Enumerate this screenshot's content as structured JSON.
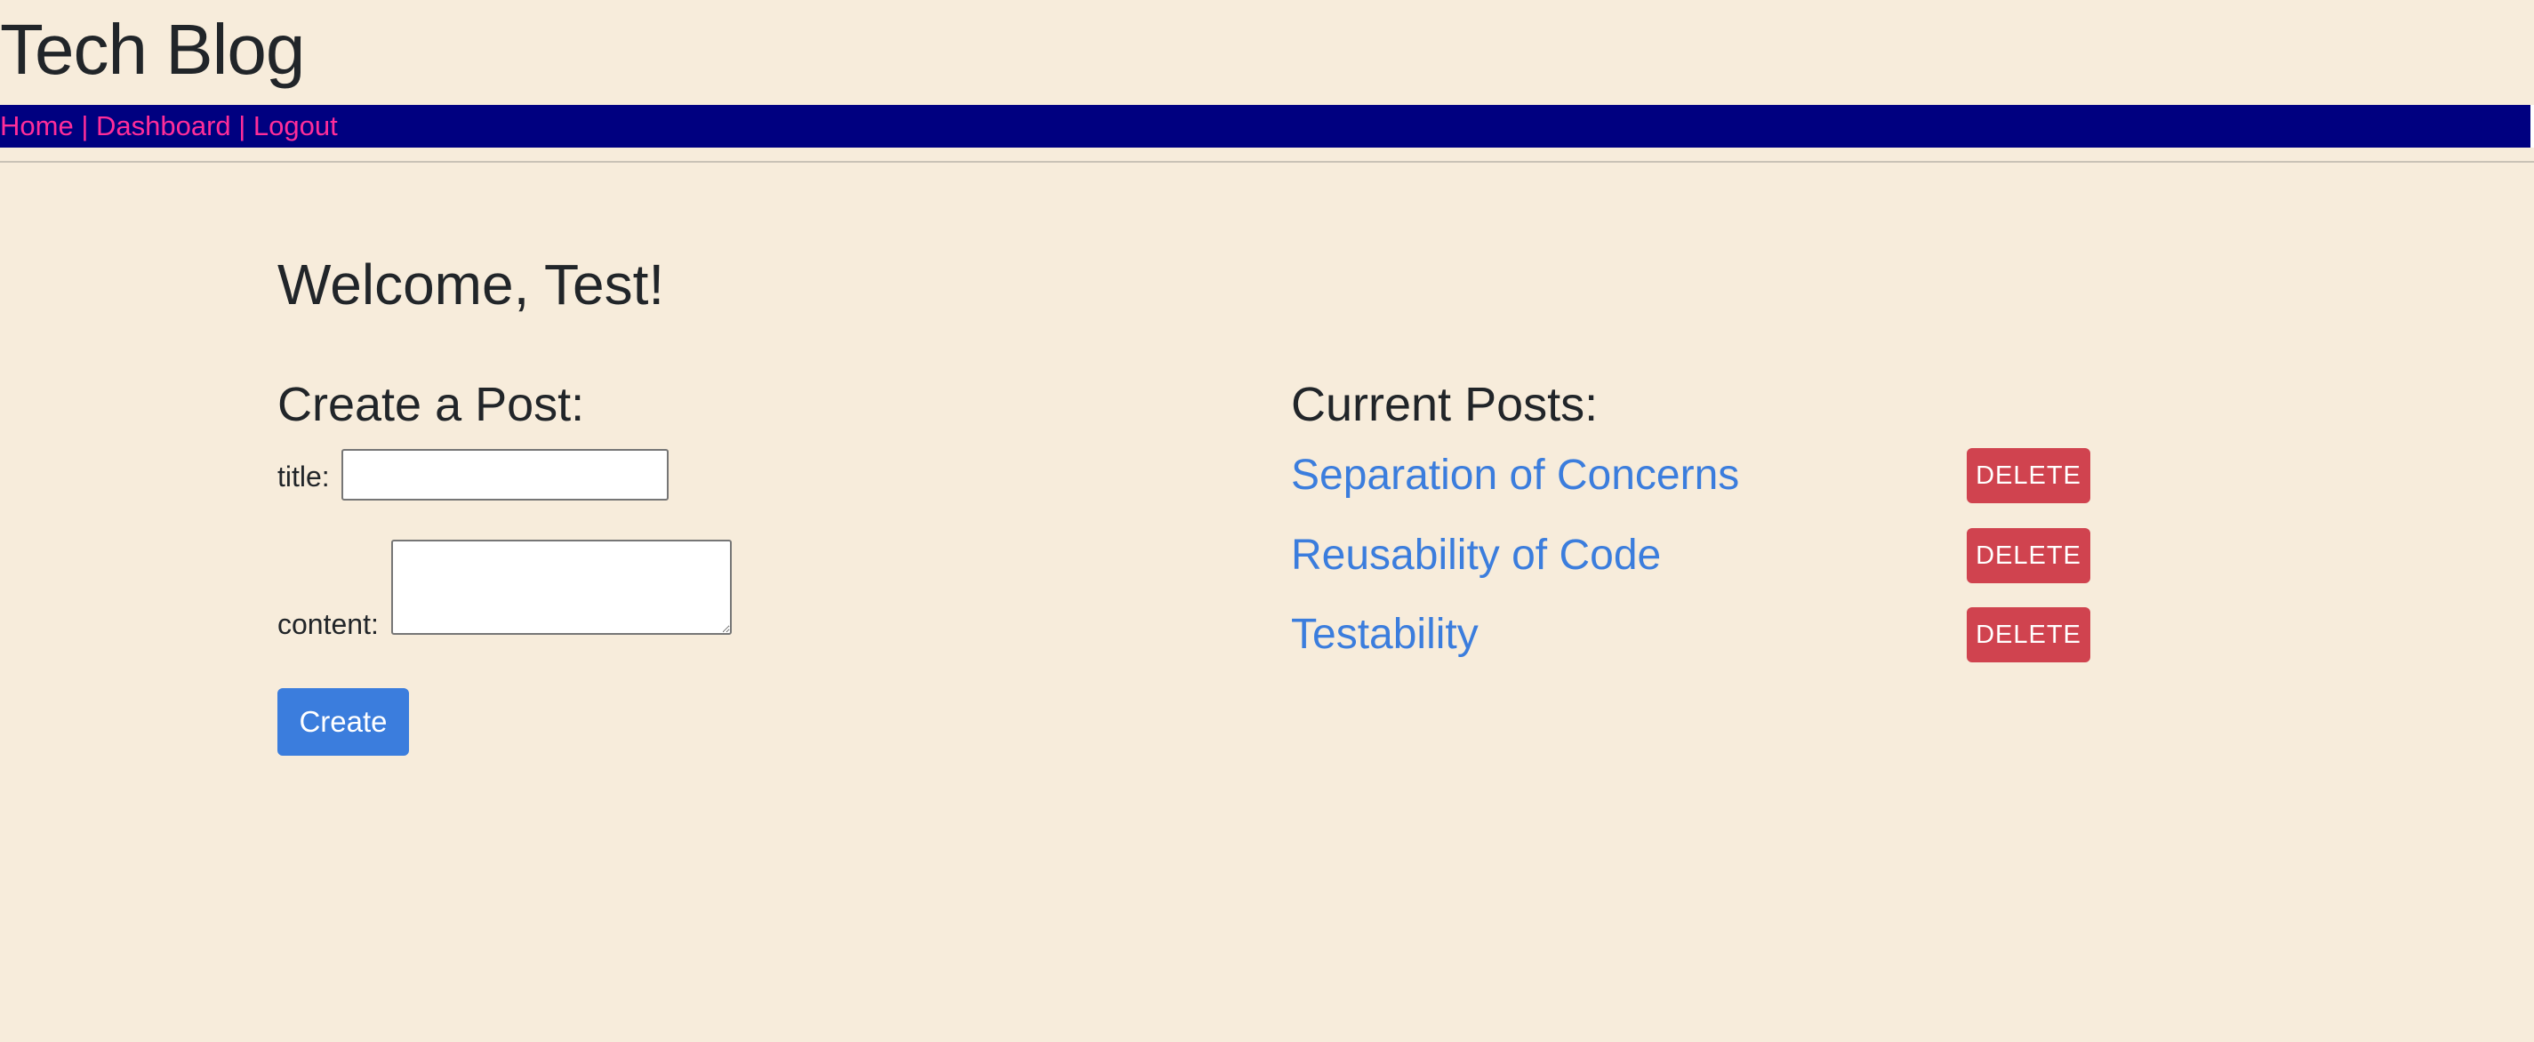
{
  "header": {
    "site_title": "Tech Blog"
  },
  "nav": {
    "home": "Home",
    "dashboard": "Dashboard",
    "logout": "Logout",
    "separator": " | "
  },
  "main": {
    "welcome": "Welcome, Test!"
  },
  "create_form": {
    "heading": "Create a Post:",
    "title_label": "title:",
    "title_value": "",
    "content_label": "content:",
    "content_value": "",
    "submit_label": "Create"
  },
  "posts": {
    "heading": "Current Posts:",
    "delete_label": "DELETE",
    "items": [
      {
        "title": "Separation of Concerns"
      },
      {
        "title": "Reusability of Code"
      },
      {
        "title": "Testability"
      }
    ]
  },
  "colors": {
    "background": "#f7ecdb",
    "nav_background": "#000080",
    "nav_link": "#ff2d9a",
    "primary": "#3b7ddd",
    "danger": "#d0434f"
  }
}
